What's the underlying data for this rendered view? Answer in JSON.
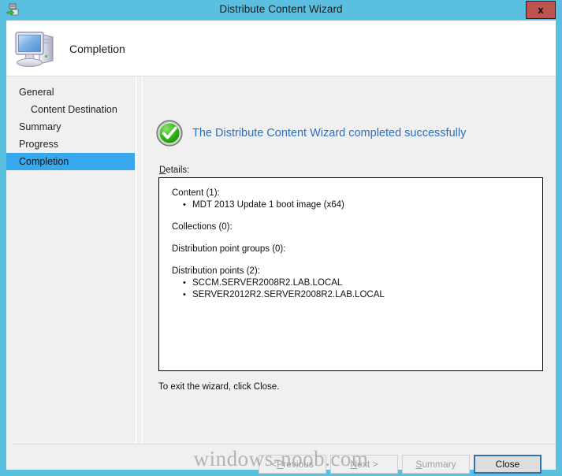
{
  "window": {
    "title": "Distribute Content Wizard",
    "title_icon": "distribute-content-icon",
    "close_label": "x"
  },
  "header": {
    "title": "Completion",
    "icon": "computer-icon"
  },
  "sidebar": {
    "items": [
      {
        "label": "General",
        "selected": false,
        "sub": false
      },
      {
        "label": "Content Destination",
        "selected": false,
        "sub": true
      },
      {
        "label": "Summary",
        "selected": false,
        "sub": false
      },
      {
        "label": "Progress",
        "selected": false,
        "sub": false
      },
      {
        "label": "Completion",
        "selected": true,
        "sub": false
      }
    ]
  },
  "main": {
    "status_icon": "success-check-icon",
    "status_text": "The Distribute Content Wizard completed successfully",
    "status_color": "#2C6FBD",
    "details_label_accel": "D",
    "details_label_rest": "etails:",
    "details": [
      {
        "heading": "Content (1):",
        "items": [
          "MDT 2013 Update 1 boot image (x64)"
        ]
      },
      {
        "heading": "Collections (0):",
        "items": []
      },
      {
        "heading": "Distribution point groups (0):",
        "items": []
      },
      {
        "heading": "Distribution points (2):",
        "items": [
          "SCCM.SERVER2008R2.LAB.LOCAL",
          "SERVER2012R2.SERVER2008R2.LAB.LOCAL"
        ]
      }
    ],
    "exit_note": "To exit the wizard, click Close."
  },
  "footer": {
    "buttons": [
      {
        "id": "previous",
        "prefix": "< ",
        "accel": "P",
        "suffix": "revious",
        "enabled": false
      },
      {
        "id": "next",
        "prefix": "",
        "accel": "N",
        "suffix": "ext >",
        "enabled": false
      },
      {
        "id": "summary",
        "prefix": "",
        "accel": "S",
        "suffix": "ummary",
        "enabled": false
      },
      {
        "id": "close",
        "prefix": "",
        "accel": "",
        "suffix": "Close",
        "enabled": true
      }
    ]
  },
  "watermark": "windows-noob.com",
  "colors": {
    "titlebar": "#5BC0E0",
    "close_button": "#BE5450",
    "selection": "#37A8EB",
    "panel": "#f0f0f0",
    "focus_border": "#2E72B0"
  }
}
